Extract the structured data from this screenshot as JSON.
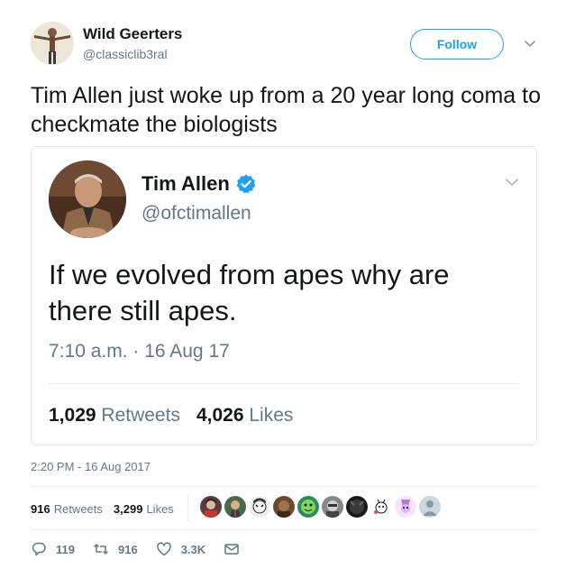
{
  "tweet": {
    "user_name": "Wild Geerters",
    "user_handle": "@classiclib3ral",
    "follow_label": "Follow",
    "text": "Tim Allen just woke up from a 20 year long coma to checkmate the biologists",
    "timestamp": "2:20 PM - 16 Aug 2017",
    "retweets_count": "916",
    "retweets_label": "Retweets",
    "likes_count": "3,299",
    "likes_label": "Likes"
  },
  "quoted": {
    "user_name": "Tim Allen",
    "user_handle": "@ofctimallen",
    "text": "If we evolved from apes why are there still apes.",
    "time": "7:10 a.m. · 16 Aug 17",
    "retweets_count": "1,029",
    "retweets_label": "Retweets",
    "likes_count": "4,026",
    "likes_label": "Likes"
  },
  "actions": {
    "reply_count": "119",
    "retweet_count": "916",
    "like_count": "3.3K"
  },
  "liker_avatars": [
    "avatar-1",
    "avatar-2",
    "avatar-3",
    "avatar-4",
    "avatar-5",
    "avatar-6",
    "avatar-7",
    "avatar-8",
    "avatar-9"
  ],
  "colors": {
    "accent": "#1da1f2",
    "text": "#14171a",
    "secondary": "#657786",
    "border": "#e1e8ed"
  }
}
